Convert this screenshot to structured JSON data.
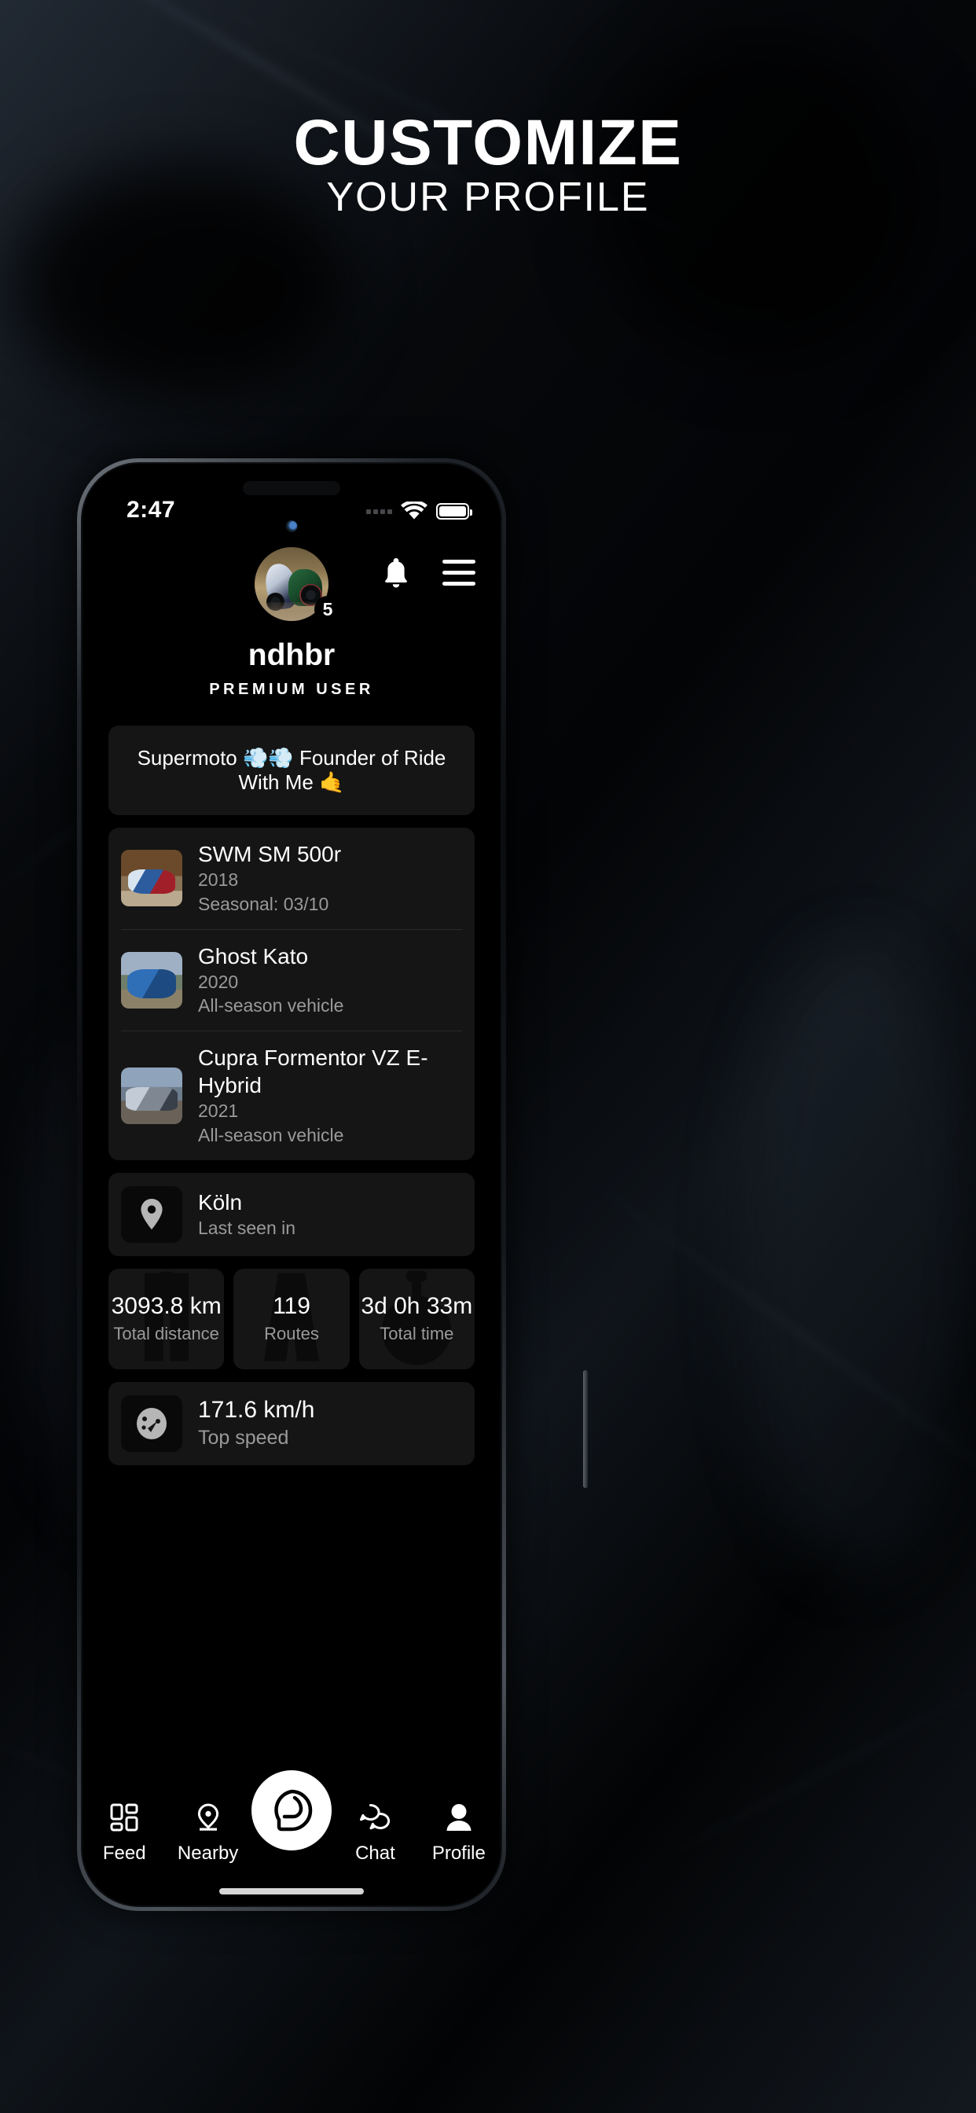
{
  "promo": {
    "headline": "CUSTOMIZE",
    "subheadline": "YOUR PROFILE"
  },
  "status_bar": {
    "time": "2:47",
    "cellular_icon": "cellular-dots-icon",
    "wifi_icon": "wifi-icon",
    "battery_icon": "battery-full-icon"
  },
  "app": {
    "topbar": {
      "notifications_icon": "bell-icon",
      "menu_icon": "hamburger-menu-icon"
    },
    "profile": {
      "avatar_icon": "avatar",
      "level_badge": "5",
      "username": "ndhbr",
      "tier": "PREMIUM USER",
      "bio": "Supermoto 💨💨 Founder of Ride With Me 🤙"
    },
    "vehicles": [
      {
        "name": "SWM SM 500r",
        "year": "2018",
        "season": "Seasonal: 03/10"
      },
      {
        "name": "Ghost Kato",
        "year": "2020",
        "season": "All-season vehicle"
      },
      {
        "name": "Cupra Formentor VZ E-Hybrid",
        "year": "2021",
        "season": "All-season vehicle"
      }
    ],
    "location": {
      "icon": "map-pin-icon",
      "city": "Köln",
      "label": "Last seen in"
    },
    "stats": [
      {
        "value": "3093.8 km",
        "label": "Total distance",
        "icon": "road-icon"
      },
      {
        "value": "119",
        "label": "Routes",
        "icon": "map-marker-icon"
      },
      {
        "value": "3d 0h 33m",
        "label": "Total time",
        "icon": "stopwatch-icon"
      }
    ],
    "top_speed": {
      "icon": "speedometer-icon",
      "value": "171.6 km/h",
      "label": "Top speed"
    },
    "tabs": [
      {
        "label": "Feed",
        "icon": "grid-icon",
        "active": false
      },
      {
        "label": "Nearby",
        "icon": "location-pin-icon",
        "active": false
      },
      {
        "label": "",
        "icon": "helmet-icon",
        "active": false
      },
      {
        "label": "Chat",
        "icon": "chat-bubbles-icon",
        "active": false
      },
      {
        "label": "Profile",
        "icon": "person-icon",
        "active": true
      }
    ]
  },
  "colors": {
    "background": "#000000",
    "card": "#151515",
    "text_primary": "#ffffff",
    "text_secondary": "#9a9a9a",
    "accent": "#ffffff"
  }
}
